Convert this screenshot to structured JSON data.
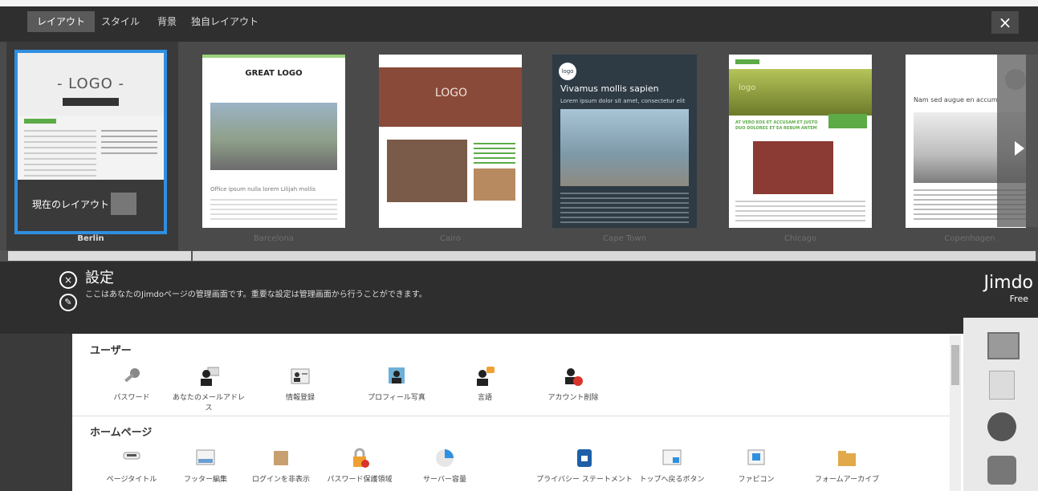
{
  "tabs": [
    {
      "label": "レイアウト",
      "active": true
    },
    {
      "label": "スタイル"
    },
    {
      "label": "背景"
    },
    {
      "label": "独自レイアウト"
    }
  ],
  "close_symbol": "×",
  "templates": [
    {
      "name": "Berlin",
      "logo": "- LOGO -",
      "current_label": "現在のレイアウト"
    },
    {
      "name": "Barcelona",
      "logo": "GREAT LOGO",
      "headline": "Office ipsum nulla lorem Lilijah mollis"
    },
    {
      "name": "Cairo",
      "logo": "LOGO"
    },
    {
      "name": "Cape Town",
      "logo": "logo",
      "headline": "Vivamus mollis sapien",
      "sub": "Lorem ipsum dolor sit amet, consectetur elit"
    },
    {
      "name": "Chicago",
      "logo": "logo",
      "headline": "AT VERO EOS ET ACCUSAM ET JUSTO DUO DOLORES ET EA REBUM ANTEM"
    },
    {
      "name": "Copenhagen",
      "headline": "Nam sed augue en accum"
    }
  ],
  "settings": {
    "title": "設定",
    "description": "ここはあなたのJimdoページの管理画面です。重要な設定は管理画面から行うことができます。",
    "brand": "Jimdo",
    "plan": "Free"
  },
  "sections": [
    {
      "title": "ユーザー",
      "items": [
        {
          "label": "パスワード",
          "icon": "key-icon"
        },
        {
          "label": "あなたのメールアドレス",
          "icon": "user-mail-icon"
        },
        {
          "label": "情報登録",
          "icon": "id-card-icon"
        },
        {
          "label": "プロフィール写真",
          "icon": "profile-photo-icon"
        },
        {
          "label": "言語",
          "icon": "language-icon"
        },
        {
          "label": "アカウント削除",
          "icon": "delete-account-icon"
        }
      ]
    },
    {
      "title": "ホームページ",
      "items": [
        {
          "label": "ページタイトル",
          "icon": "page-title-icon"
        },
        {
          "label": "フッター編集",
          "icon": "footer-icon"
        },
        {
          "label": "ログインを非表示",
          "icon": "login-hide-icon"
        },
        {
          "label": "パスワード保護領域",
          "icon": "lock-icon"
        },
        {
          "label": "サーバー容量",
          "icon": "pie-chart-icon"
        },
        {
          "label": "プライバシー ステートメント",
          "icon": "privacy-icon"
        },
        {
          "label": "トップへ戻るボタン",
          "icon": "back-to-top-icon"
        },
        {
          "label": "ファビコン",
          "icon": "favicon-icon"
        },
        {
          "label": "フォームアーカイブ",
          "icon": "folder-icon"
        }
      ]
    }
  ],
  "colors": {
    "accent": "#2f8fe0",
    "dark": "#2e2e2e",
    "green": "#5cab47"
  }
}
